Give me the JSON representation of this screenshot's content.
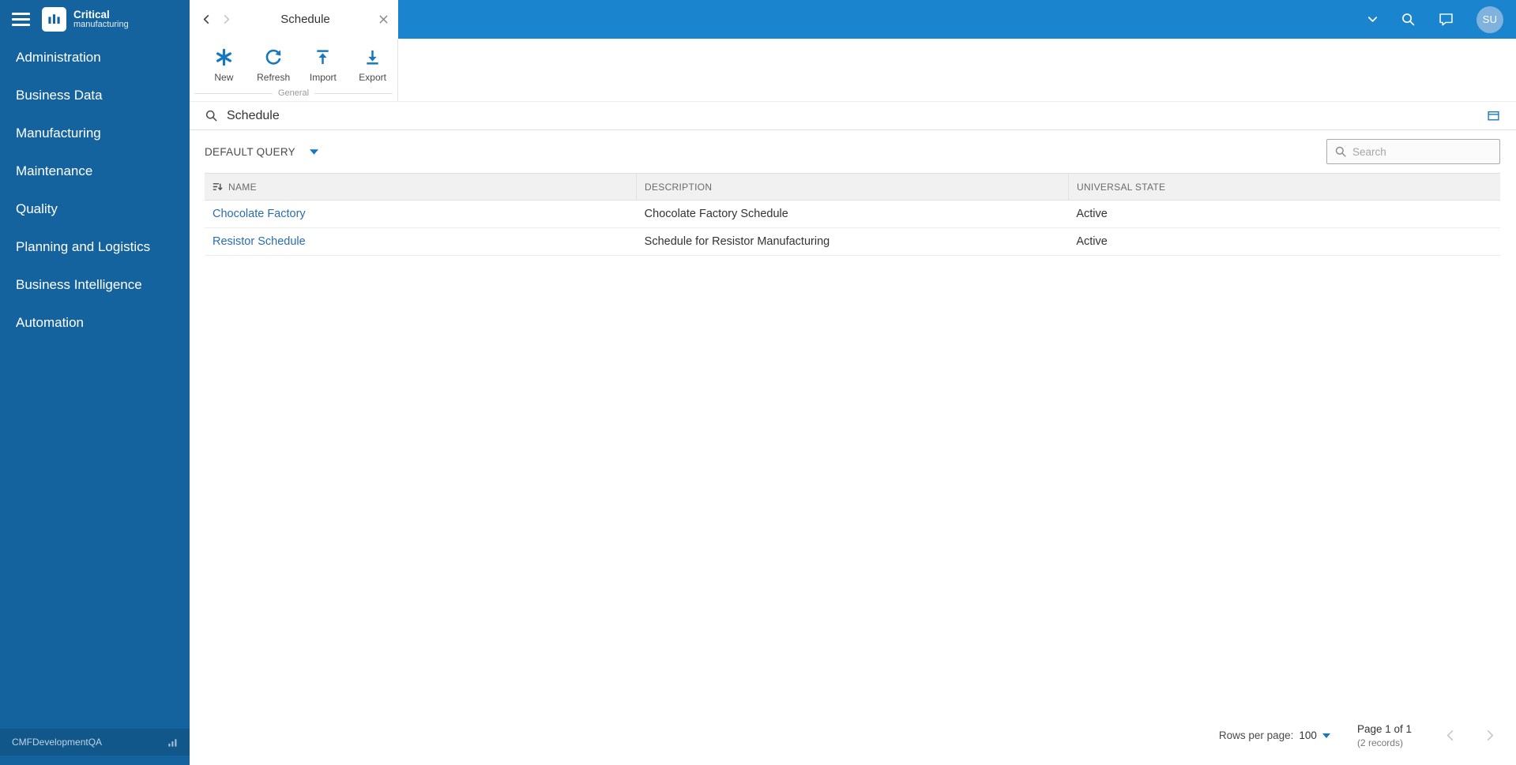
{
  "sidebar": {
    "logo_title": "Critical",
    "logo_subtitle": "manufacturing",
    "items": [
      {
        "label": "Administration"
      },
      {
        "label": "Business Data"
      },
      {
        "label": "Manufacturing"
      },
      {
        "label": "Maintenance"
      },
      {
        "label": "Quality"
      },
      {
        "label": "Planning and Logistics"
      },
      {
        "label": "Business Intelligence"
      },
      {
        "label": "Automation"
      }
    ],
    "footer": "CMFDevelopmentQA"
  },
  "header": {
    "tab_title": "Schedule",
    "avatar_initials": "SU"
  },
  "ribbon": {
    "group_label": "General",
    "buttons": [
      {
        "label": "New",
        "icon": "asterisk-icon"
      },
      {
        "label": "Refresh",
        "icon": "refresh-icon"
      },
      {
        "label": "Import",
        "icon": "import-up-icon"
      },
      {
        "label": "Export",
        "icon": "export-down-icon"
      }
    ]
  },
  "page": {
    "title": "Schedule",
    "query_label": "DEFAULT QUERY",
    "search_placeholder": "Search"
  },
  "table": {
    "columns": [
      "NAME",
      "DESCRIPTION",
      "UNIVERSAL STATE"
    ],
    "rows": [
      {
        "name": "Chocolate Factory",
        "description": "Chocolate Factory Schedule",
        "state": "Active"
      },
      {
        "name": "Resistor Schedule",
        "description": "Schedule for Resistor Manufacturing",
        "state": "Active"
      }
    ]
  },
  "footer": {
    "rows_per_page_label": "Rows per page:",
    "rows_per_page_value": "100",
    "page_info": "Page 1 of 1",
    "records_info": "(2 records)"
  },
  "colors": {
    "topbar": "#1A85CE",
    "sidebar": "#15639E",
    "accent": "#1878BE",
    "link": "#2A6DAF"
  }
}
